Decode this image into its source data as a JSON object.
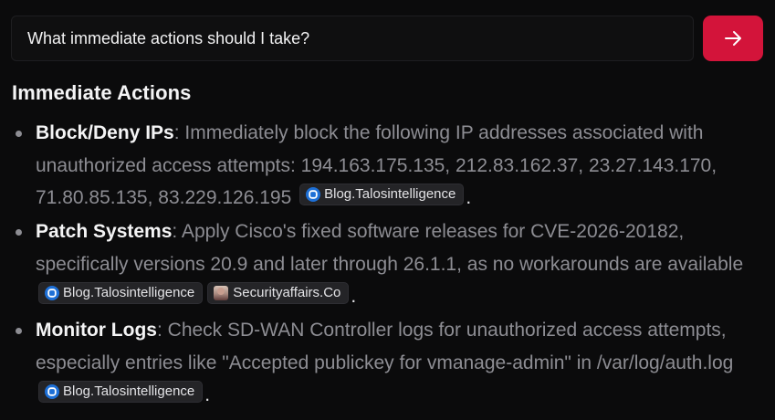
{
  "query": {
    "text": "What immediate actions should I take?"
  },
  "send_button": {
    "icon": "arrow-right-icon",
    "color": "#d3143a"
  },
  "section": {
    "heading": "Immediate Actions"
  },
  "actions": [
    {
      "term": "Block/Deny IPs",
      "text": ": Immediately block the following IP addresses associated with unauthorized access attempts: 194.163.175.135, 212.83.162.37, 23.27.143.170, 71.80.85.135, 83.229.126.195",
      "sources": [
        "Blog.Talosintelligence"
      ],
      "end": "."
    },
    {
      "term": "Patch Systems",
      "text": ": Apply Cisco's fixed software releases for CVE-2026-20182, specifically versions 20.9 and later through 26.1.1, as no workarounds are available",
      "sources": [
        "Blog.Talosintelligence",
        "Securityaffairs.Co"
      ],
      "end": "."
    },
    {
      "term": "Monitor Logs",
      "text": ": Check SD-WAN Controller logs for unauthorized access attempts, especially entries like \"Accepted publickey for vmanage-admin\" in /var/log/auth.log",
      "sources": [
        "Blog.Talosintelligence"
      ],
      "end": "."
    }
  ],
  "colors": {
    "background": "#0b0b0c",
    "accent": "#d3143a",
    "chip_background": "#242427",
    "talos_icon": "#1d6fd6"
  }
}
